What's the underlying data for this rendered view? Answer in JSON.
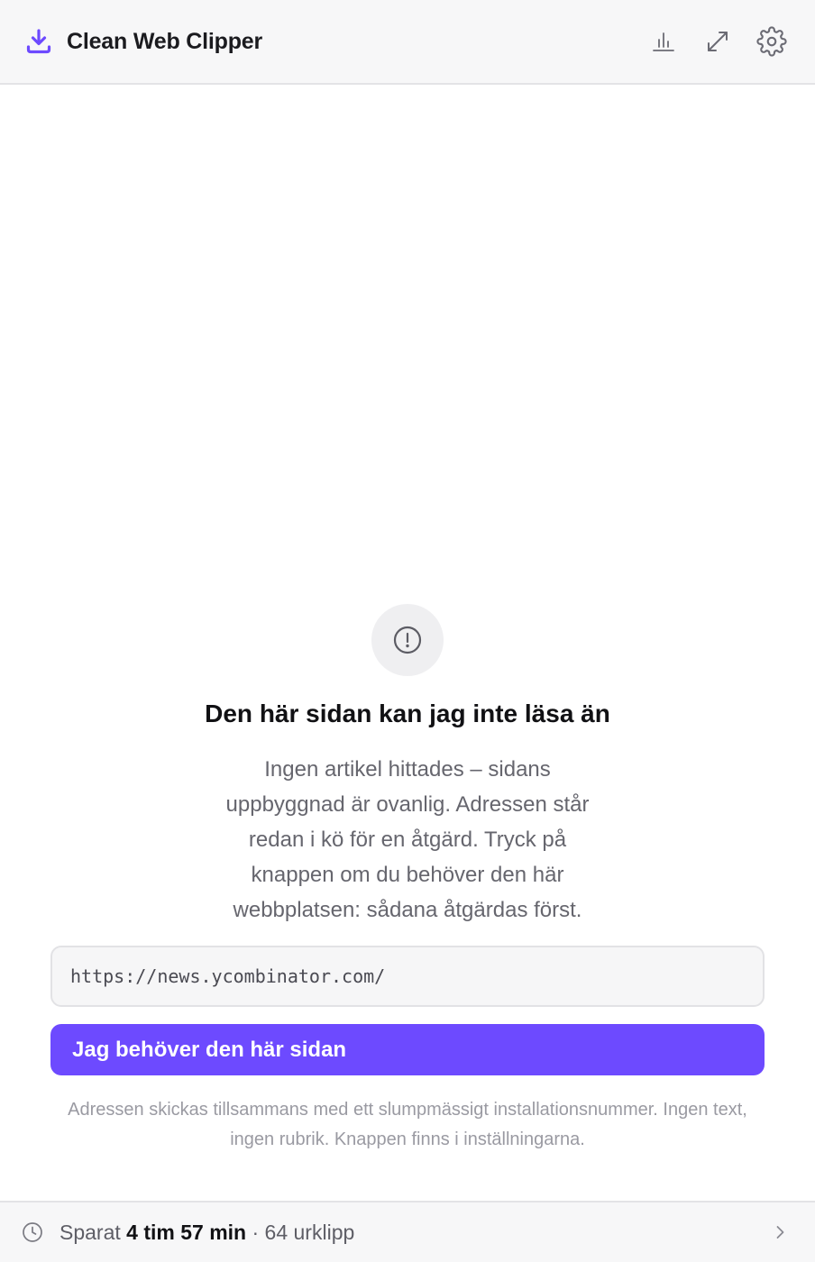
{
  "app": {
    "title": "Clean Web Clipper",
    "accent_color": "#6d4aff"
  },
  "header": {
    "logo_icon": "download-tray-icon",
    "actions": [
      {
        "name": "stats",
        "icon": "bar-chart-icon"
      },
      {
        "name": "expand",
        "icon": "expand-icon"
      },
      {
        "name": "settings",
        "icon": "gear-icon"
      }
    ]
  },
  "error": {
    "icon": "alert-circle-icon",
    "title": "Den här sidan kan jag inte läsa än",
    "description": "Ingen artikel hittades – sidans uppbyggnad är ovanlig. Adressen står redan i kö för en åtgärd. Tryck på knappen om du behöver den här webbplatsen: sådana åtgärdas först.",
    "url": "https://news.ycombinator.com/",
    "button_label": "Jag behöver den här sidan",
    "note": "Adressen skickas tillsammans med ett slumpmässigt installationsnummer. Ingen text, ingen rubrik. Knappen finns i inställningarna."
  },
  "footer": {
    "icon": "clock-icon",
    "saved_label": "Sparat",
    "saved_time": "4 tim 57 min",
    "separator": "·",
    "clips": "64 urklipp",
    "chevron_icon": "chevron-right-icon"
  }
}
